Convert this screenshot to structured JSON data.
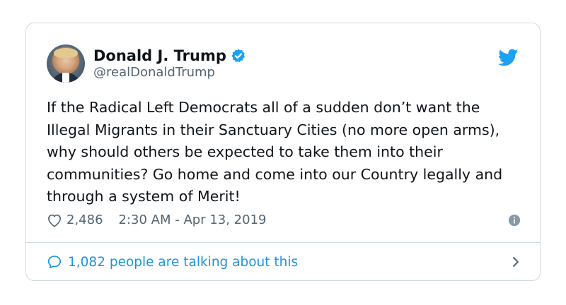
{
  "user": {
    "display_name": "Donald J. Trump",
    "handle": "@realDonaldTrump",
    "verified": true
  },
  "tweet": {
    "text": "If the Radical Left Democrats all of a sudden don’t want the Illegal Migrants in their Sanctuary Cities (no more open arms), why should others be expected to take them into their communities? Go home and come into our Country legally and through a system of Merit!",
    "likes": "2,486",
    "timestamp": "2:30 AM - Apr 13, 2019"
  },
  "conversation": {
    "label": "1,082 people are talking about this"
  },
  "icons": {
    "brand": "twitter-bird-icon",
    "verified": "verified-badge-icon",
    "like": "heart-icon",
    "info": "info-icon",
    "reply": "speech-bubble-icon",
    "more": "chevron-right-icon"
  },
  "colors": {
    "brand_blue": "#1da1f2",
    "link_blue": "#1b95e0",
    "text_primary": "#0f1419",
    "text_secondary": "#536471",
    "border": "#cfd9de"
  }
}
